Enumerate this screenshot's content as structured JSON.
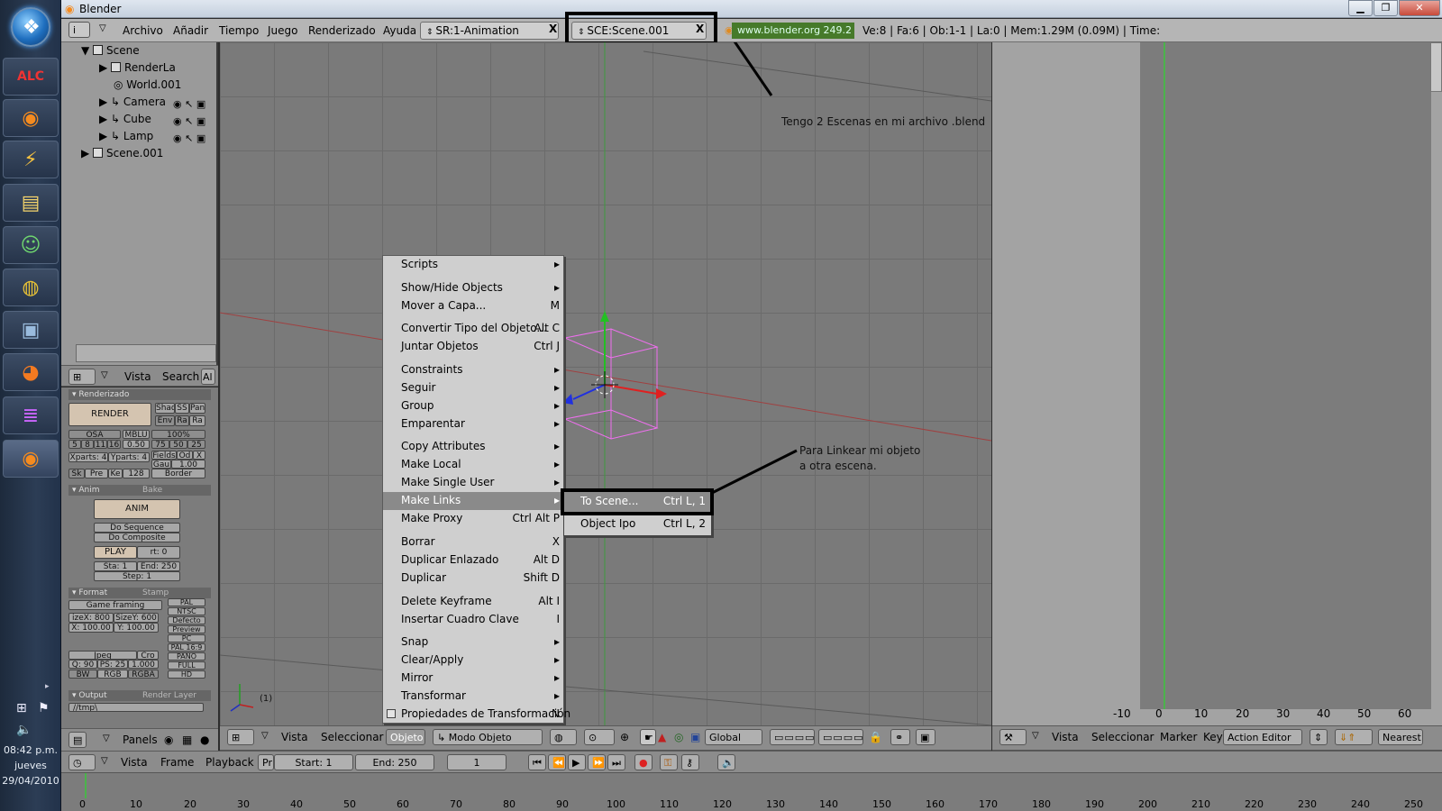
{
  "window": {
    "title": "Blender"
  },
  "taskbar": {
    "icons": [
      "alc-icon",
      "blender-icon",
      "winamp-icon",
      "folder-icon",
      "messenger-icon",
      "globe-search-icon",
      "monitor-icon",
      "firefox-icon",
      "winrar-icon",
      "blender-icon"
    ],
    "time": "08:42 p.m.",
    "day": "jueves",
    "date": "29/04/2010"
  },
  "topbar": {
    "menus": [
      "Archivo",
      "Añadir",
      "Tiempo",
      "Juego",
      "Renderizado",
      "Ayuda"
    ],
    "screen_field": "SR:1-Animation",
    "scene_field": "SCE:Scene.001",
    "x": "X",
    "website": "www.blender.org 249.2",
    "stats": "Ve:8 | Fa:6 | Ob:1-1 | La:0 | Mem:1.29M (0.09M) | Time:"
  },
  "outliner": {
    "rows": [
      "Scene",
      "RenderLa",
      "World.001",
      "Camera",
      "Cube",
      "Lamp",
      "Scene.001"
    ]
  },
  "outliner_header": {
    "vista": "Vista",
    "search": "Search",
    "al": "Al"
  },
  "buttons": {
    "render_panel": "Renderizado",
    "render_btn": "RENDER",
    "shad": "Shad",
    "ss": "SS",
    "pan": "Pan",
    "env": "Env",
    "ra": "Ra",
    "ra2": "Ra",
    "osa": "OSA",
    "mblu": "MBLU",
    "pct100": "100%",
    "osa_vals": [
      "5",
      "8",
      "11",
      "16"
    ],
    "mb_val": "0.50",
    "pct_vals": [
      "75",
      "50",
      "25"
    ],
    "xparts": "Xparts: 4",
    "yparts": "Yparts: 4",
    "fields": "Fields",
    "od": "Od",
    "x_lbl": "X",
    "gau": "Gau",
    "gau_val": "1.00",
    "sk": "Sk",
    "pre": "Pre",
    "ke": "Ke",
    "k128": "128",
    "border": "Border",
    "anim_tab": "Anim",
    "bake_tab": "Bake",
    "anim_btn": "ANIM",
    "do_seq": "Do Sequence",
    "do_comp": "Do Composite",
    "play": "PLAY",
    "rt": "rt: 0",
    "sta": "Sta: 1",
    "end": "End: 250",
    "step": "Step: 1",
    "format_tab": "Format",
    "stamp_tab": "Stamp",
    "game_framing": "Game framing settings",
    "sizex": "izeX: 800",
    "sizey": "SizeY: 600",
    "x100": "X: 100.00",
    "y100": "Y: 100.00",
    "presets": [
      "PAL",
      "NTSC",
      "Defecto",
      "Preview",
      "PC",
      "PAL 16:9",
      "PANO",
      "FULL",
      "HD"
    ],
    "jpeg": "Jpeg",
    "cro": "Cro",
    "q90": "Q: 90",
    "fps25": "PS: 25",
    "fps_val": "1.000",
    "bw": "BW",
    "rgb": "RGB",
    "rgba": "RGBA",
    "output_tab": "Output",
    "render_layer_tab": "Render Layer",
    "tmp": "//tmp\\"
  },
  "buttons_header": {
    "panels": "Panels"
  },
  "view3d": {
    "frame_label": "(1)"
  },
  "view3d_header": {
    "vista": "Vista",
    "seleccionar": "Seleccionar",
    "objeto": "Objeto",
    "mode": "Modo Objeto",
    "orientation": "Global"
  },
  "context_menu": {
    "items": [
      {
        "label": "Scripts",
        "sc": "▸"
      },
      {
        "label": "Show/Hide Objects",
        "sc": "▸"
      },
      {
        "label": "Mover a Capa...",
        "sc": "M"
      },
      {
        "label": "Convertir Tipo del Objeto...",
        "sc": "Alt C"
      },
      {
        "label": "Juntar Objetos",
        "sc": "Ctrl J"
      },
      {
        "label": "Constraints",
        "sc": "▸"
      },
      {
        "label": "Seguir",
        "sc": "▸"
      },
      {
        "label": "Group",
        "sc": "▸"
      },
      {
        "label": "Emparentar",
        "sc": "▸"
      },
      {
        "label": "Copy Attributes",
        "sc": "▸"
      },
      {
        "label": "Make Local",
        "sc": "▸"
      },
      {
        "label": "Make Single User",
        "sc": "▸"
      },
      {
        "label": "Make Links",
        "sc": "▸"
      },
      {
        "label": "Make Proxy",
        "sc": "Ctrl Alt P"
      },
      {
        "label": "Borrar",
        "sc": "X"
      },
      {
        "label": "Duplicar Enlazado",
        "sc": "Alt D"
      },
      {
        "label": "Duplicar",
        "sc": "Shift D"
      },
      {
        "label": "Delete Keyframe",
        "sc": "Alt I"
      },
      {
        "label": "Insertar Cuadro Clave",
        "sc": "I"
      },
      {
        "label": "Snap",
        "sc": "▸"
      },
      {
        "label": "Clear/Apply",
        "sc": "▸"
      },
      {
        "label": "Mirror",
        "sc": "▸"
      },
      {
        "label": "Transformar",
        "sc": "▸"
      },
      {
        "label": "Propiedades de Transformación",
        "sc": "N"
      }
    ]
  },
  "submenu": {
    "items": [
      {
        "label": "To Scene...",
        "sc": "Ctrl L, 1"
      },
      {
        "label": "Object Ipo",
        "sc": "Ctrl L, 2"
      }
    ]
  },
  "annotations": {
    "scenes": "Tengo 2 Escenas en mi archivo .blend",
    "link1": "Para Linkear mi objeto",
    "link2": "a otra escena."
  },
  "action_editor": {
    "ruler": [
      "-10",
      "0",
      "10",
      "20",
      "30",
      "40",
      "50",
      "60"
    ],
    "vista": "Vista",
    "seleccionar": "Seleccionar",
    "marker": "Marker",
    "key": "Key",
    "mode": "Action Editor",
    "nearest": "Nearest"
  },
  "timeline_header": {
    "vista": "Vista",
    "frame": "Frame",
    "playback": "Playback",
    "pr": "Pr",
    "start": "Start: 1",
    "end": "End: 250",
    "current": "1"
  },
  "timeline": {
    "ruler": [
      "0",
      "10",
      "20",
      "30",
      "40",
      "50",
      "60",
      "70",
      "80",
      "90",
      "100",
      "110",
      "120",
      "130",
      "140",
      "150",
      "160",
      "170",
      "180",
      "190",
      "200",
      "210",
      "220",
      "230",
      "240",
      "250"
    ]
  }
}
